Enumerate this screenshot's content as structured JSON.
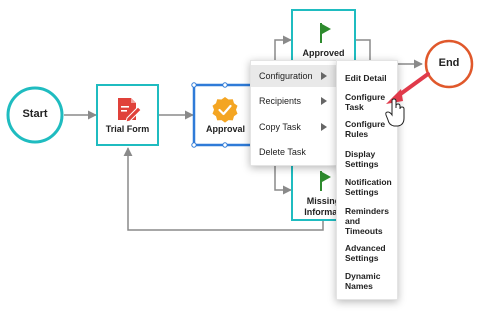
{
  "nodes": {
    "start": "Start",
    "end": "End",
    "trial_form": "Trial Form",
    "approval": "Approval",
    "approved": "Approved",
    "missing_line1": "Missing",
    "missing_line2": "Informati"
  },
  "context_menu": {
    "items": [
      {
        "label": "Configuration",
        "has_submenu": true
      },
      {
        "label": "Recipients",
        "has_submenu": true
      },
      {
        "label": "Copy Task",
        "has_submenu": true
      },
      {
        "label": "Delete Task",
        "has_submenu": false
      }
    ]
  },
  "submenu": {
    "items": [
      {
        "lines": [
          "Edit Detail"
        ]
      },
      {
        "lines": [
          "Configure",
          "Task"
        ]
      },
      {
        "lines": [
          "Configure",
          "Rules"
        ]
      },
      {
        "lines": [
          "Display",
          "Settings"
        ]
      },
      {
        "lines": [
          "Notification",
          "Settings"
        ]
      },
      {
        "lines": [
          "Reminders",
          "and",
          "Timeouts"
        ]
      },
      {
        "lines": [
          "Advanced",
          "Settings"
        ]
      },
      {
        "lines": [
          "Dynamic",
          "Names"
        ]
      }
    ]
  },
  "colors": {
    "teal": "#1fbcc0",
    "selected_border": "#2f7bd8",
    "end_circle": "#e0582b",
    "form_icon": "#e0413a",
    "badge": "#f4a522",
    "flag": "#2e8b2e",
    "pointer_arrow": "#e03a4a"
  }
}
